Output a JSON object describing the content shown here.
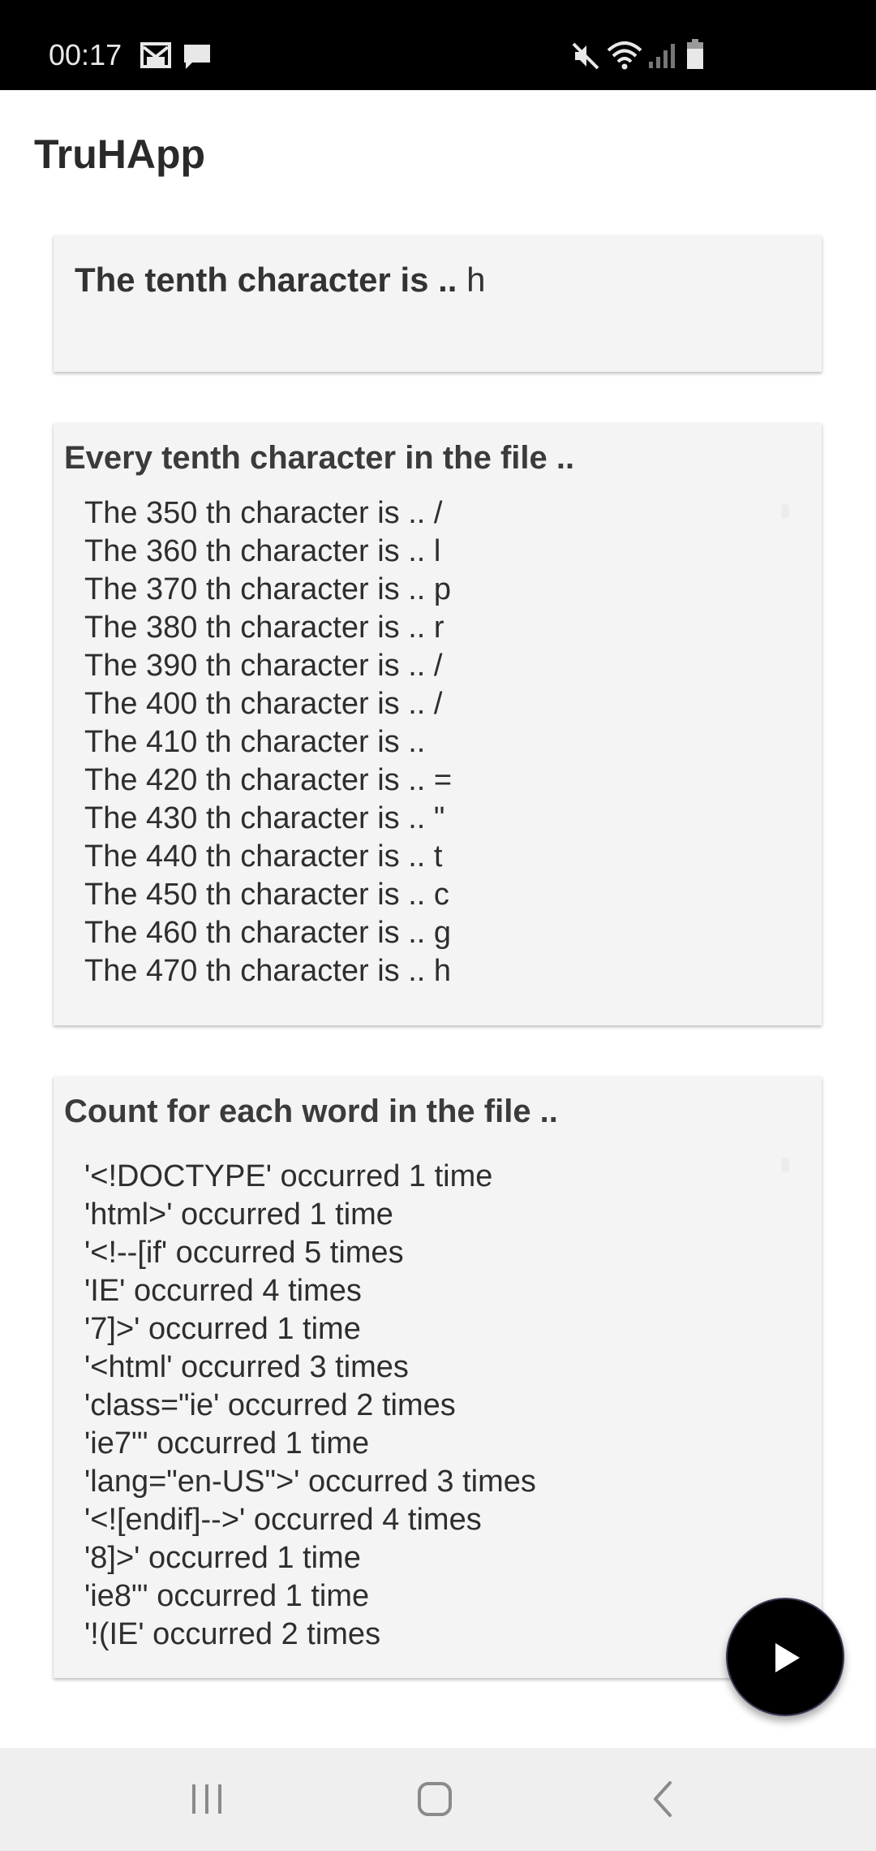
{
  "status_bar": {
    "time": "00:17",
    "icons": [
      "gmail-icon",
      "message-icon",
      "mute-icon",
      "wifi-icon",
      "signal-icon",
      "battery-icon"
    ]
  },
  "app": {
    "title": "TruHApp"
  },
  "tenth_card": {
    "label": "The tenth character is ..",
    "value": "h"
  },
  "every_tenth_card": {
    "heading": "Every tenth character in the file ..",
    "items": [
      "The 350 th character is .. /",
      "The 360 th character is .. l",
      "The 370 th character is .. p",
      "The 380 th character is .. r",
      "The 390 th character is .. /",
      "The 400 th character is .. /",
      "The 410 th character is ..",
      "The 420 th character is .. =",
      "The 430 th character is .. \"",
      "The 440 th character is .. t",
      "The 450 th character is .. c",
      "The 460 th character is .. g",
      "The 470 th character is .. h"
    ]
  },
  "word_count_card": {
    "heading": "Count for each word in the file ..",
    "items": [
      "'<!DOCTYPE' occurred 1 time",
      "'html>' occurred 1 time",
      "'<!--[if' occurred 5 times",
      "'IE' occurred 4 times",
      "'7]>' occurred 1 time",
      "'<html' occurred 3 times",
      "'class=\"ie' occurred 2 times",
      "'ie7\"' occurred 1 time",
      "'lang=\"en-US\">' occurred 3 times",
      "'<![endif]-->' occurred 4 times",
      "'8]>' occurred 1 time",
      "'ie8\"' occurred 1 time",
      "'!(IE' occurred 2 times"
    ]
  },
  "fab": {
    "icon": "play-icon"
  },
  "nav_bar": {
    "icons": [
      "recent-apps-icon",
      "home-icon",
      "back-icon"
    ]
  }
}
